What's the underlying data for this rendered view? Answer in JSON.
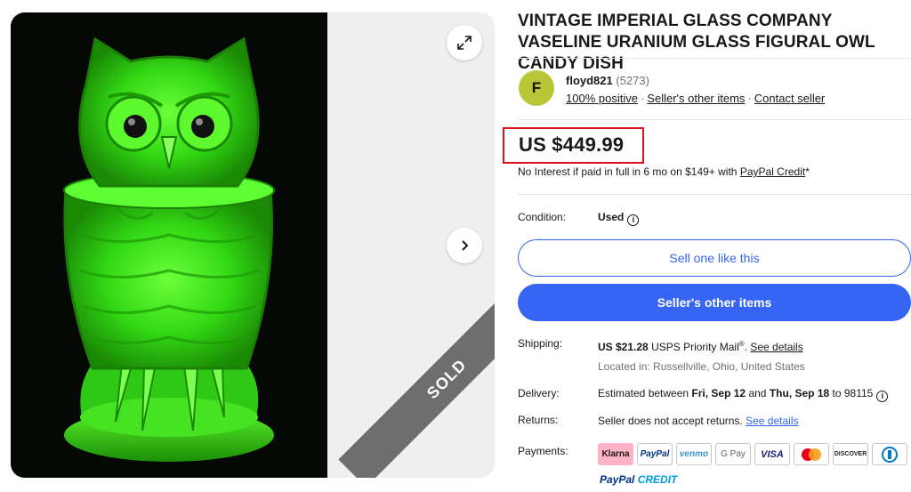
{
  "gallery": {
    "sold_label": "SOLD"
  },
  "listing": {
    "title": "VINTAGE IMPERIAL GLASS COMPANY VASELINE URANIUM GLASS FIGURAL OWL CANDY DISH",
    "seller": {
      "avatar_letter": "F",
      "name": "floyd821",
      "feedback_count": "(5273)",
      "positive": "100% positive",
      "other_items": "Seller's other items",
      "contact": "Contact seller"
    },
    "price": "US $449.99",
    "credit_text": "No Interest if paid in full in 6 mo on $149+ with",
    "credit_link": "PayPal Credit",
    "credit_suffix": "*",
    "condition_label": "Condition:",
    "condition_value": "Used",
    "buttons": {
      "sell_one": "Sell one like this",
      "seller_items": "Seller's other items"
    },
    "shipping_label": "Shipping:",
    "shipping_price": "US $21.28",
    "shipping_service": "USPS Priority Mail",
    "shipping_reg": "®",
    "shipping_sep": ".",
    "shipping_link": "See details",
    "location": "Located in: Russellville, Ohio, United States",
    "delivery_label": "Delivery:",
    "delivery_prefix": "Estimated between",
    "delivery_start": "Fri, Sep 12",
    "delivery_and": "and",
    "delivery_end": "Thu, Sep 18",
    "delivery_to": "to 98115",
    "returns_label": "Returns:",
    "returns_text": "Seller does not accept returns.",
    "returns_link": "See details",
    "payments_label": "Payments:",
    "payment_methods": [
      "Klarna",
      "PayPal",
      "venmo",
      "G Pay",
      "VISA",
      "Mastercard",
      "DISCOVER",
      "Diners Club"
    ],
    "paypal_credit_1": "PayPal",
    "paypal_credit_2": "CREDIT"
  },
  "colors": {
    "accent": "#3665f3",
    "highlight_box": "#e0101c",
    "avatar": "#b9c736",
    "uranium_green": "#39e61a"
  },
  "icons": [
    "expand-icon",
    "chevron-right-icon",
    "info-icon"
  ]
}
